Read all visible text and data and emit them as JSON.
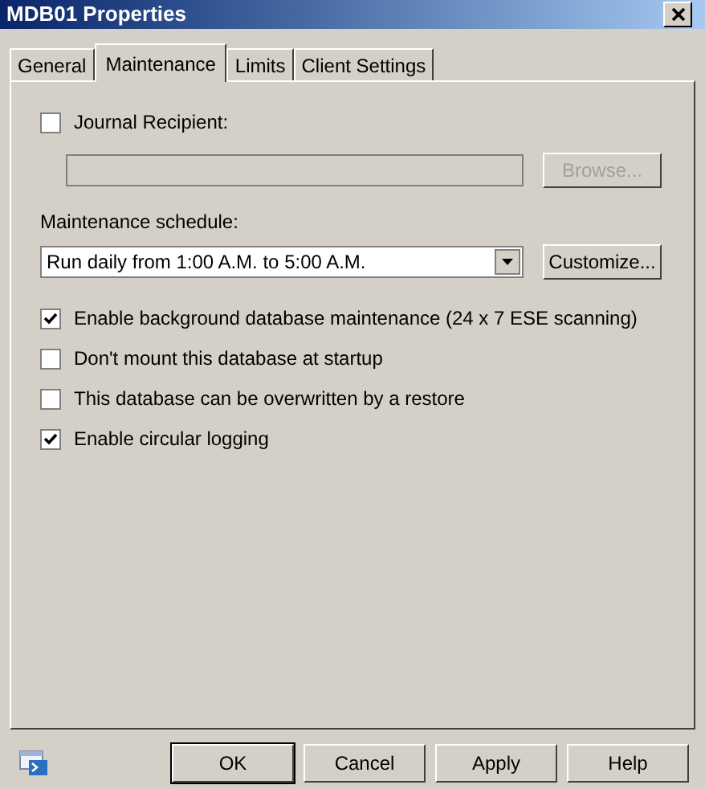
{
  "window": {
    "title": "MDB01 Properties"
  },
  "tabs": [
    {
      "label": "General",
      "selected": false
    },
    {
      "label": "Maintenance",
      "selected": true
    },
    {
      "label": "Limits",
      "selected": false
    },
    {
      "label": "Client Settings",
      "selected": false
    }
  ],
  "journal": {
    "label": "Journal Recipient:",
    "checked": false,
    "browse": {
      "label": "Browse...",
      "disabled": true
    }
  },
  "schedule": {
    "label": "Maintenance schedule:",
    "value": "Run daily from 1:00 A.M. to 5:00 A.M.",
    "customize": "Customize..."
  },
  "options": [
    {
      "label": "Enable background database maintenance (24 x 7 ESE scanning)",
      "checked": true
    },
    {
      "label": "Don't mount this database at startup",
      "checked": false
    },
    {
      "label": "This database can be overwritten by a restore",
      "checked": false
    },
    {
      "label": "Enable circular logging",
      "checked": true
    }
  ],
  "buttons": [
    {
      "label": "OK",
      "default": true
    },
    {
      "label": "Cancel",
      "default": false
    },
    {
      "label": "Apply",
      "default": false
    },
    {
      "label": "Help",
      "default": false
    }
  ]
}
